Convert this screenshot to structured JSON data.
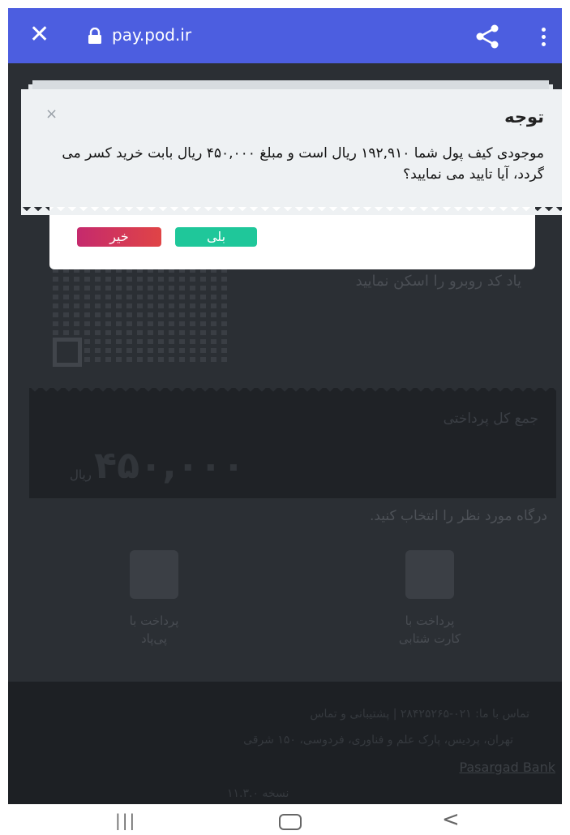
{
  "browser": {
    "url": "pay.pod.ir",
    "close_glyph": "✕",
    "icons": [
      "close-icon",
      "lock-icon",
      "share-icon",
      "more-vert-icon"
    ]
  },
  "background_page": {
    "scan_instruction": "یاد کد روبرو را اسکن نمایید",
    "payment_label": "جمع کل پرداختی",
    "amount": "۴۵۰,۰۰۰",
    "currency": "ریال",
    "gateway_prompt": "درگاه مورد نظر را انتخاب کنید.",
    "gateways": [
      {
        "line1": "پرداخت با",
        "line2": "کارت شتابی"
      },
      {
        "line1": "پرداخت با",
        "line2": "پی‌پاد"
      }
    ],
    "footer": {
      "line1": "تماس با ما: ۰۲۱-۲۸۴۲۵۲۶۵ | پشتیبانی و تماس",
      "line2": "تهران، پردیس، پارک علم و فناوری، فردوسی، ۱۵۰ شرقی",
      "link": "Pasargad Bank",
      "line4": "نسخه ۱۱.۳.۰"
    }
  },
  "dialog": {
    "title": "توجه",
    "message": "موجودی کیف پول شما ۱۹۲,۹۱۰ ریال است و مبلغ ۴۵۰,۰۰۰ ریال بابت خرید کسر می گردد، آیا تایید می نمایید؟",
    "close_glyph": "×",
    "yes_label": "بلی",
    "no_label": "خیر"
  },
  "navbar": {
    "recent_glyph": "|||",
    "back_glyph": "<"
  },
  "colors": {
    "toolbar": "#4c5ee0",
    "overlay": "#2b2f34",
    "yes": "#1fc79a",
    "no": "#d4345a"
  }
}
